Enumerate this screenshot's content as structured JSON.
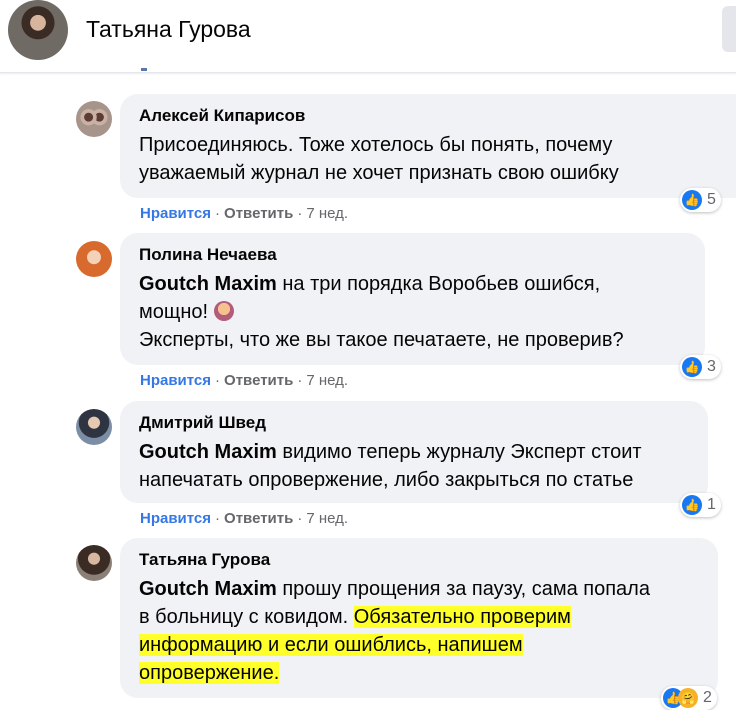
{
  "header": {
    "title": "Татьяна Гурова"
  },
  "comments": [
    {
      "author": "Алексей Кипарисов",
      "lines": [
        "Присоединяюсь. Тоже хотелось бы понять, почему",
        "уважаемый журнал не хочет признать свою ошибку"
      ],
      "like": "Нравится",
      "reply": "Ответить",
      "time": "7 нед.",
      "reactions": "5"
    },
    {
      "author": "Полина Нечаева",
      "mention": "Goutch Maxim",
      "lines": [
        " на три порядка Воробьев ошибся,",
        "мощно!",
        "Эксперты, что же вы такое печатаете, не проверив?"
      ],
      "like": "Нравится",
      "reply": "Ответить",
      "time": "7 нед.",
      "reactions": "3"
    },
    {
      "author": "Дмитрий Швед",
      "mention": "Goutch Maxim",
      "lines": [
        " видимо теперь журналу Эксперт стоит",
        "напечатать опровержение, либо закрыться по статье"
      ],
      "like": "Нравится",
      "reply": "Ответить",
      "time": "7 нед.",
      "reactions": "1"
    },
    {
      "author": "Татьяна Гурова",
      "mention": "Goutch Maxim",
      "lines": [
        " прошу прощения за паузу, сама попала",
        "в больницу с ковидом. ",
        "Обязательно проверим",
        "информацию и если ошиблись, напишем",
        "опровержение."
      ],
      "reactions": "2"
    }
  ],
  "icons": {
    "like": "like-icon",
    "care": "care-icon",
    "emoji": "woman-shrugging-emoji"
  },
  "colors": {
    "like_blue": "#1877f2",
    "highlight": "#ffff29",
    "bubble": "#f0f2f5"
  }
}
